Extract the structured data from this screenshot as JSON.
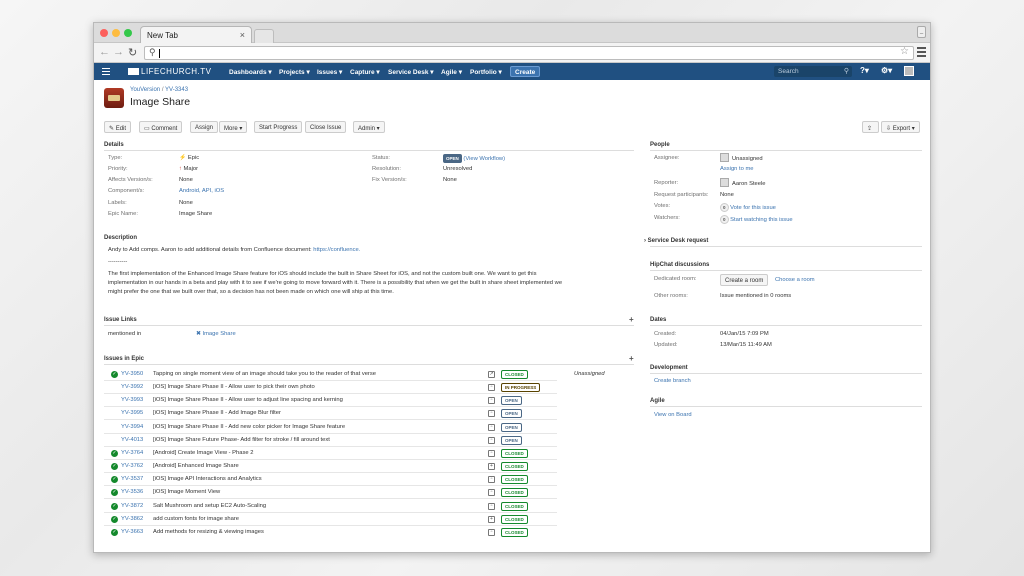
{
  "browser": {
    "tab_title": "New Tab",
    "tab_close": "×",
    "address_value": ""
  },
  "nav": {
    "logo": "LIFECHURCH.TV",
    "items": [
      "Dashboards ▾",
      "Projects ▾",
      "Issues ▾",
      "Capture ▾",
      "Service Desk ▾",
      "Agile ▾",
      "Portfolio ▾"
    ],
    "create": "Create",
    "search_placeholder": "Search",
    "help": "?▾",
    "gear": "⚙▾"
  },
  "issue": {
    "project": "YouVersion",
    "sep": "/",
    "key": "YV-3343",
    "title": "Image Share"
  },
  "actions": {
    "edit": "Edit",
    "comment": "Comment",
    "assign": "Assign",
    "more": "More ▾",
    "start_progress": "Start Progress",
    "close_issue": "Close Issue",
    "admin": "Admin ▾",
    "export": "Export ▾"
  },
  "details": {
    "heading": "Details",
    "left": [
      {
        "label": "Type:",
        "value": "Epic"
      },
      {
        "label": "Priority:",
        "value": "Major"
      },
      {
        "label": "Affects Version/s:",
        "value": "None"
      },
      {
        "label": "Component/s:",
        "value": "Android, API, iOS"
      },
      {
        "label": "Labels:",
        "value": "None"
      },
      {
        "label": "Epic Name:",
        "value": "Image Share"
      }
    ],
    "right": [
      {
        "label": "Status:",
        "value": "OPEN",
        "extra": "(View Workflow)"
      },
      {
        "label": "Resolution:",
        "value": "Unresolved"
      },
      {
        "label": "Fix Version/s:",
        "value": "None"
      }
    ]
  },
  "description": {
    "heading": "Description",
    "line1": "Andy to Add comps. Aaron to add additional details from Confluence document: ",
    "link": "https://confluence.",
    "divider": "----------",
    "p1": "The first implementation of the Enhanced Image Share feature for iOS should include the built in Share Sheet for iOS, and not the custom built one. We want to get this",
    "p2": "implementation in our hands in a beta and play with it to see if we're going to move forward with it. There is a possibility that when we get the built in share sheet implemented we",
    "p3": "might prefer the one that we built over that, so a decision has not been made on which one will ship at this time."
  },
  "issue_links": {
    "heading": "Issue Links",
    "label": "mentioned in",
    "value": "Image Share"
  },
  "epic": {
    "heading": "Issues in Epic",
    "rows": [
      {
        "key": "YV-3950",
        "summary": "Tapping on single moment view of an image should take you to the reader of that verse",
        "status": "CLOSED",
        "assignee": "Unassigned",
        "done": true
      },
      {
        "key": "YV-3992",
        "summary": "[iOS] Image Share Phase II - Allow user to pick their own photo",
        "status": "IN PROGRESS",
        "assignee": "",
        "done": false
      },
      {
        "key": "YV-3993",
        "summary": "[iOS] Image Share Phase II - Allow user to adjust line spacing and kerning",
        "status": "OPEN",
        "assignee": "",
        "done": false
      },
      {
        "key": "YV-3995",
        "summary": "[iOS] Image Share Phase II - Add Image Blur filter",
        "status": "OPEN",
        "assignee": "",
        "done": false
      },
      {
        "key": "YV-3994",
        "summary": "[iOS] Image Share Phase II - Add new color picker for Image Share feature",
        "status": "OPEN",
        "assignee": "",
        "done": false
      },
      {
        "key": "YV-4013",
        "summary": "[iOS] Image Share Future Phase- Add filter for stroke / fill around text",
        "status": "OPEN",
        "assignee": "",
        "done": false
      },
      {
        "key": "YV-3764",
        "summary": "[Android] Create Image View - Phase 2",
        "status": "CLOSED",
        "assignee": "",
        "done": true
      },
      {
        "key": "YV-3762",
        "summary": "[Android] Enhanced Image Share",
        "status": "CLOSED",
        "assignee": "",
        "done": true
      },
      {
        "key": "YV-3537",
        "summary": "[iOS] Image API Interactions and Analytics",
        "status": "CLOSED",
        "assignee": "",
        "done": true
      },
      {
        "key": "YV-3536",
        "summary": "[iOS] Image Moment View",
        "status": "CLOSED",
        "assignee": "",
        "done": true
      },
      {
        "key": "YV-3872",
        "summary": "Salt Mushroom and setup EC2 Auto-Scaling",
        "status": "CLOSED",
        "assignee": "",
        "done": true
      },
      {
        "key": "YV-3862",
        "summary": "add custom fonts for image share",
        "status": "CLOSED",
        "assignee": "",
        "done": true
      },
      {
        "key": "YV-3663",
        "summary": "Add methods for resizing & viewing images",
        "status": "CLOSED",
        "assignee": "",
        "done": true
      },
      {
        "key": "YV-3302",
        "summary": "Add New Moment Type for Image Share",
        "status": "CLOSED",
        "assignee": "",
        "done": true
      }
    ]
  },
  "people": {
    "heading": "People",
    "assignee_label": "Assignee:",
    "assignee": "Unassigned",
    "assign_me": "Assign to me",
    "reporter_label": "Reporter:",
    "reporter": "Aaron Steele",
    "participants_label": "Request participants:",
    "participants": "None",
    "votes_label": "Votes:",
    "votes_count": "0",
    "votes_link": "Vote for this issue",
    "watchers_label": "Watchers:",
    "watchers_count": "0",
    "watchers_link": "Start watching this issue"
  },
  "service_desk": {
    "heading": "Service Desk request"
  },
  "hipchat": {
    "heading": "HipChat discussions",
    "dedicated_label": "Dedicated room:",
    "create_room": "Create a room",
    "choose_room": "Choose a room",
    "other_label": "Other rooms:",
    "other_value": "Issue mentioned in 0 rooms"
  },
  "dates": {
    "heading": "Dates",
    "created_label": "Created:",
    "created": "04/Jan/15 7:09 PM",
    "updated_label": "Updated:",
    "updated": "13/Mar/15 11:49 AM"
  },
  "development": {
    "heading": "Development",
    "create_branch": "Create branch"
  },
  "agile": {
    "heading": "Agile",
    "view_board": "View on Board"
  }
}
